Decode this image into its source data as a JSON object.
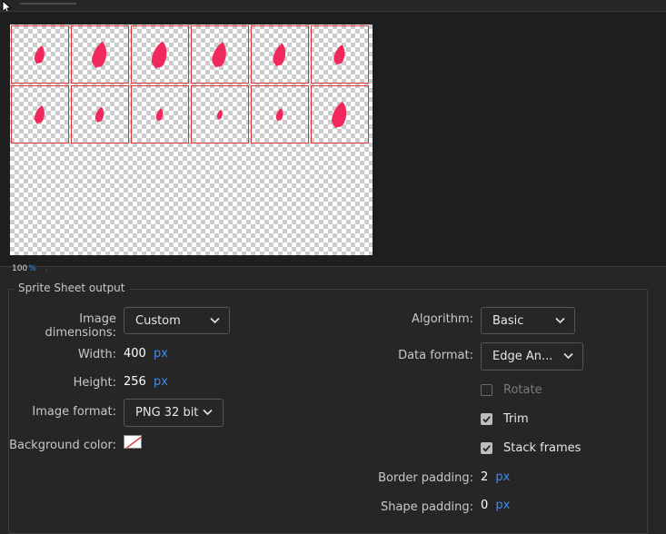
{
  "preview": {
    "zoom_value": "100",
    "zoom_unit": "%",
    "frame_rows": [
      [
        1.0,
        1.45,
        1.5,
        1.4,
        1.25,
        1.1
      ],
      [
        1.0,
        0.85,
        0.7,
        0.55,
        0.7,
        1.45
      ]
    ]
  },
  "panel": {
    "title": "Sprite Sheet output",
    "image_dimensions_label": "Image dimensions:",
    "image_dimensions_value": "Custom",
    "width_label": "Width:",
    "width_value": "400",
    "width_unit": "px",
    "height_label": "Height:",
    "height_value": "256",
    "height_unit": "px",
    "image_format_label": "Image format:",
    "image_format_value": "PNG 32 bit",
    "background_color_label": "Background color:",
    "algorithm_label": "Algorithm:",
    "algorithm_value": "Basic",
    "data_format_label": "Data format:",
    "data_format_value": "Edge An...",
    "rotate_label": "Rotate",
    "trim_label": "Trim",
    "stack_frames_label": "Stack frames",
    "border_padding_label": "Border padding:",
    "border_padding_value": "2",
    "border_padding_unit": "px",
    "shape_padding_label": "Shape padding:",
    "shape_padding_value": "0",
    "shape_padding_unit": "px"
  },
  "colors": {
    "accent": "#3d8be8",
    "frame_border": "#d63a3a",
    "sprite": "#f0285c"
  }
}
